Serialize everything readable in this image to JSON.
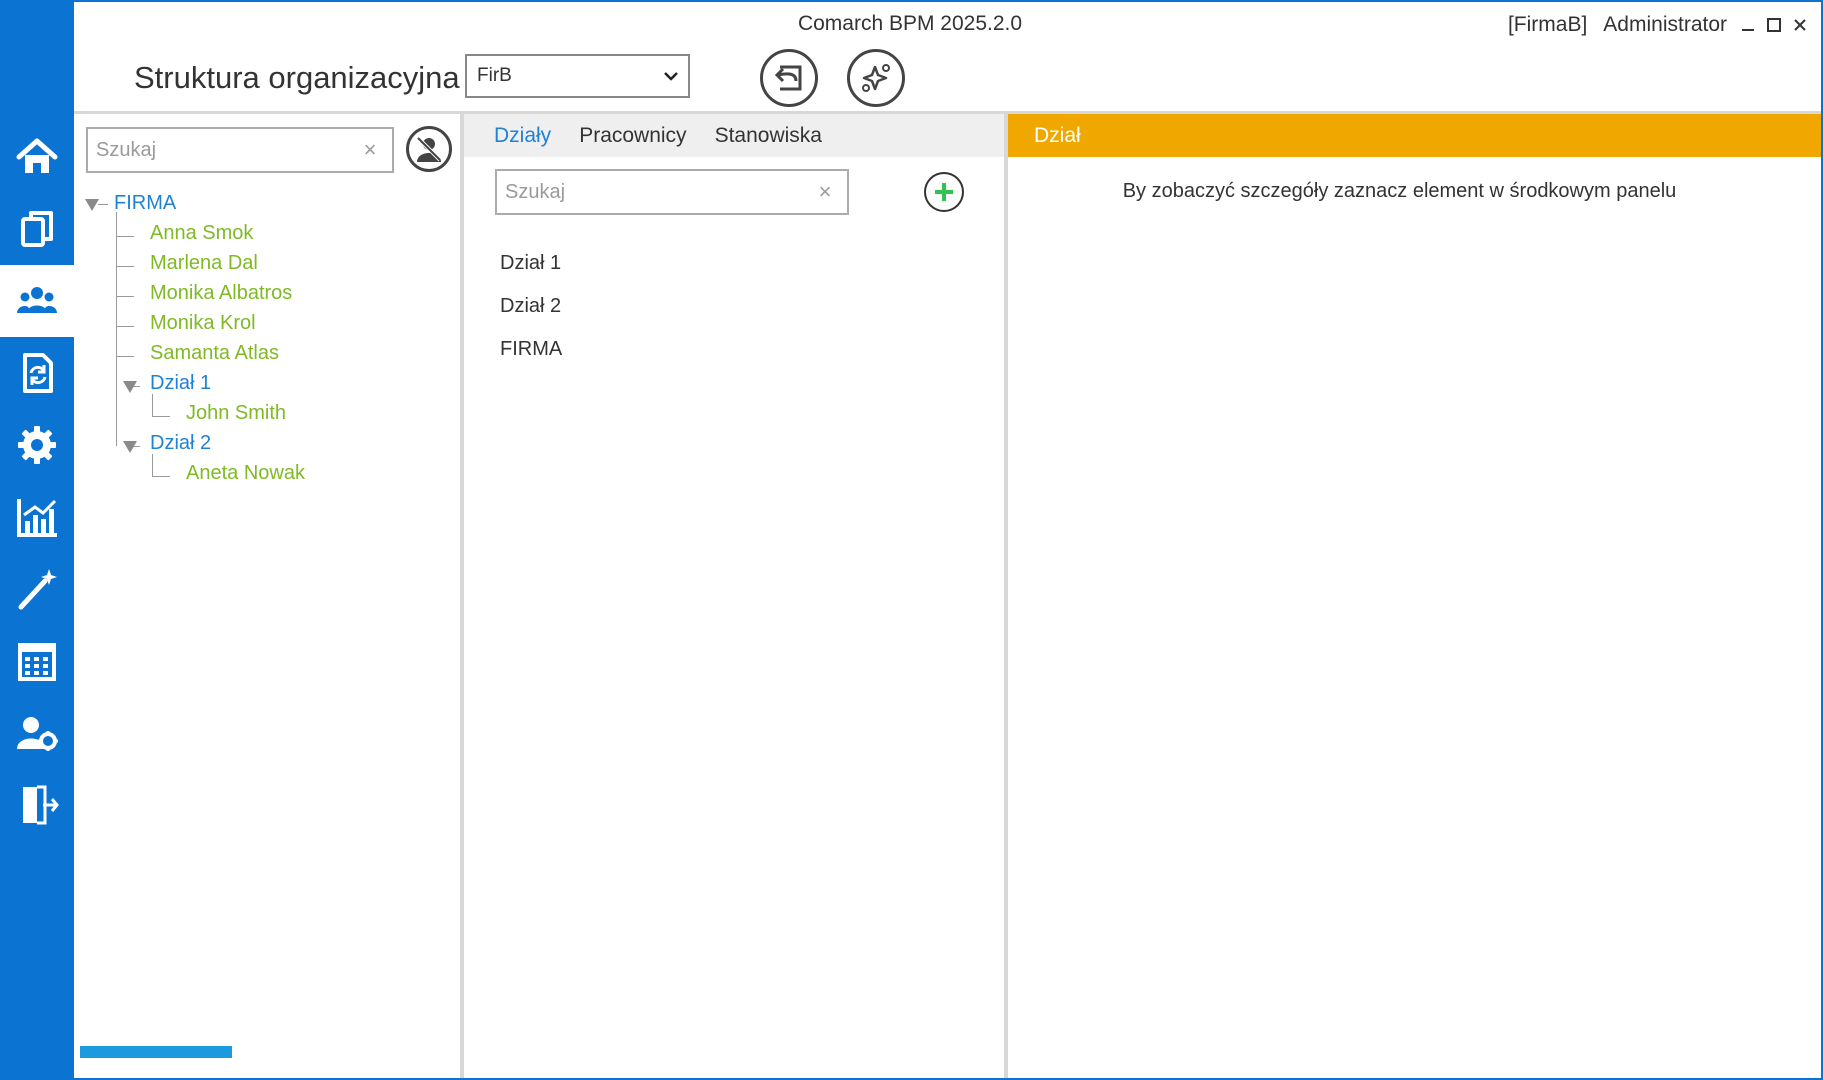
{
  "app": {
    "title": "Comarch BPM 2025.2.0",
    "company": "[FirmaB]",
    "user": "Administrator"
  },
  "window_controls": {
    "minimize": "–",
    "maximize": "□",
    "close": "✕"
  },
  "nav": {
    "items": [
      {
        "icon": "home-icon",
        "active": false
      },
      {
        "icon": "documents-icon",
        "active": false
      },
      {
        "icon": "users-icon",
        "active": true
      },
      {
        "icon": "workflow-document-icon",
        "active": false
      },
      {
        "icon": "gear-icon",
        "active": false
      },
      {
        "icon": "chart-icon",
        "active": false
      },
      {
        "icon": "magic-wand-icon",
        "active": false
      },
      {
        "icon": "calendar-icon",
        "active": false
      },
      {
        "icon": "user-settings-icon",
        "active": false
      },
      {
        "icon": "exit-icon",
        "active": false
      }
    ],
    "color": "#0b74d3"
  },
  "header": {
    "title": "Struktura organizacyjna",
    "company_select": "FirB"
  },
  "left_panel": {
    "search": {
      "placeholder": "Szukaj"
    },
    "tree": {
      "root": "FIRMA",
      "people": [
        "Anna Smok",
        "Marlena Dal",
        "Monika Albatros",
        "Monika Krol",
        "Samanta Atlas"
      ],
      "dept1": {
        "label": "Dział 1",
        "person": "John Smith"
      },
      "dept2": {
        "label": "Dział 2",
        "person": "Aneta Nowak"
      }
    },
    "progress": 1
  },
  "mid_panel": {
    "tabs": [
      "Działy",
      "Pracownicy",
      "Stanowiska"
    ],
    "active_tab": "Działy",
    "search": {
      "placeholder": "Szukaj"
    },
    "items": [
      "Dział 1",
      "Dział 2",
      "FIRMA"
    ]
  },
  "right_panel": {
    "header": "Dział",
    "message": "By zobaczyć szczegóły zaznacz element w środkowym panelu"
  },
  "colors": {
    "accent": "#1f82d6",
    "person": "#7fba24",
    "detail_header": "#f0a800",
    "add": "#2ec44f"
  }
}
